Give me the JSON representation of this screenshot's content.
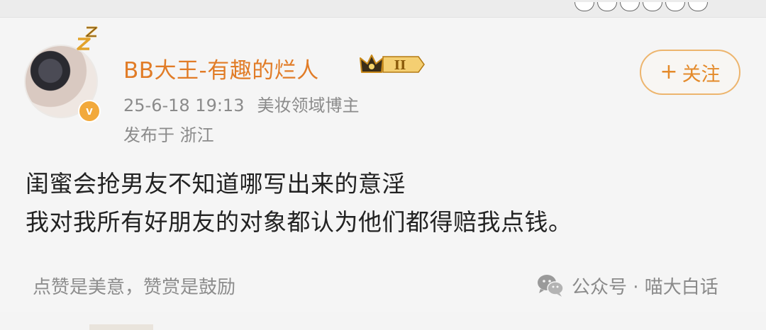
{
  "user": {
    "name": "BB大王-有趣的烂人",
    "level_badge": "II",
    "verified_badge": "v"
  },
  "meta": {
    "datetime": "25-6-18 19:13",
    "role": "美妆领域博主",
    "location": "发布于 浙江"
  },
  "follow_button": {
    "plus": "+",
    "label": "关注"
  },
  "post": {
    "lines": [
      "闺蜜会抢男友不知道哪写出来的意淫",
      "我对我所有好朋友的对象都认为他们都得赔我点钱。"
    ]
  },
  "footer": {
    "reward_text": "点赞是美意，赞赏是鼓励",
    "watermark": "公众号 · 喵大白话"
  },
  "colors": {
    "username": "#e17c27",
    "follow_border": "#edb56e",
    "verified": "#f2a93b",
    "gold": "#c98a1a"
  }
}
